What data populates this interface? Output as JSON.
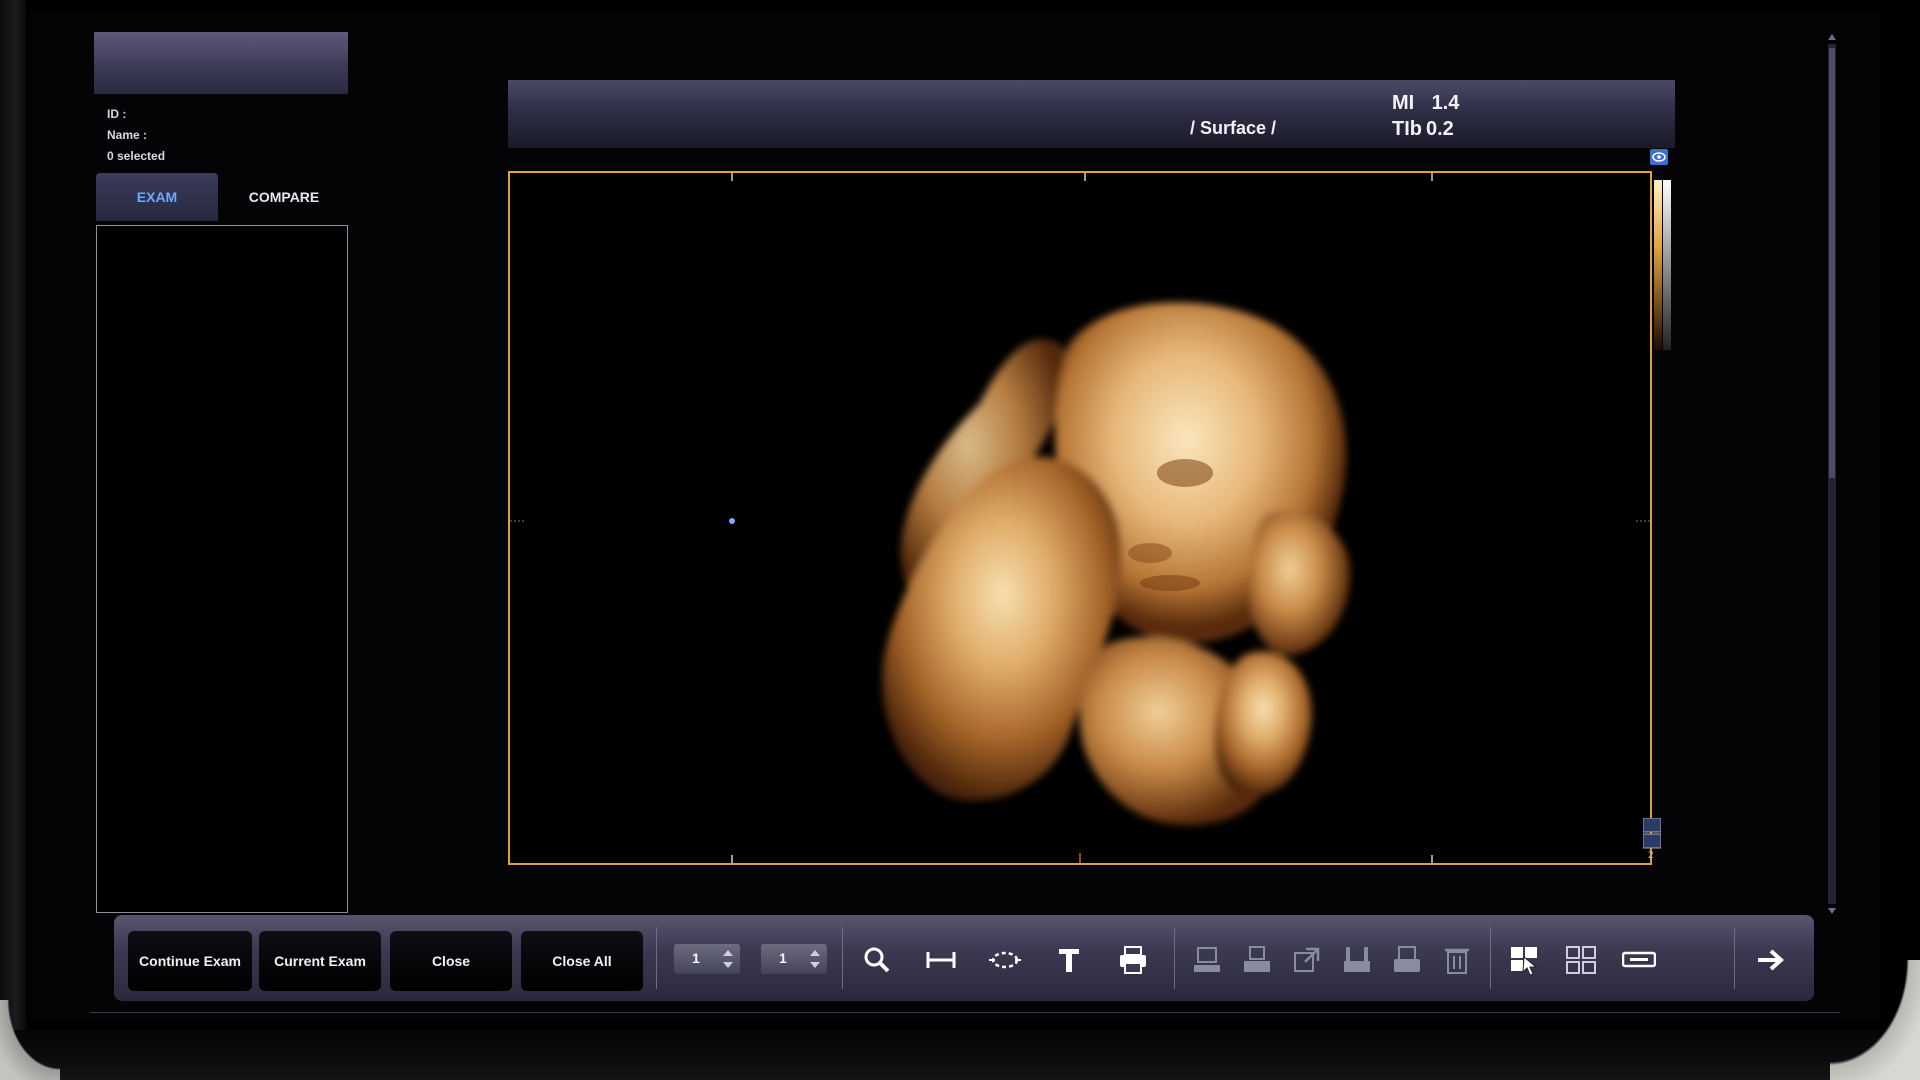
{
  "patient": {
    "id_label": "ID :",
    "name_label": "Name :",
    "selection": "0 selected"
  },
  "tabs": {
    "exam": "EXAM",
    "compare": "COMPARE"
  },
  "image": {
    "mode": "/ Surface /",
    "mi_label": "MI",
    "mi_value": "1.4",
    "tib_label": "TIb",
    "tib_value": "0.2",
    "scale_level": "2"
  },
  "toolbar": {
    "continue_exam": "Continue Exam",
    "current_exam": "Current Exam",
    "close": "Close",
    "close_all": "Close All",
    "spinner1_value": "1",
    "spinner2_value": "1"
  },
  "colors": {
    "accent": "#6fa8ff",
    "viewport_border": "#e0a040",
    "toolbar": "#3b3a52"
  },
  "icons": [
    "magnify-icon",
    "measure-distance-icon",
    "measure-ellipse-icon",
    "text-annotation-icon",
    "print-icon",
    "export-icon",
    "send-icon",
    "open-external-icon",
    "save-icon",
    "report-icon",
    "delete-icon",
    "select-icon",
    "layout-grid-icon",
    "keyboard-icon",
    "next-arrow-icon"
  ]
}
